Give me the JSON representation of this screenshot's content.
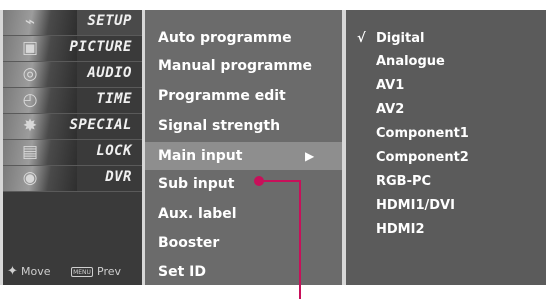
{
  "sidebar": {
    "items": [
      {
        "label": "SETUP",
        "icon": "antenna-icon",
        "glyph": "⌁",
        "active": true
      },
      {
        "label": "PICTURE",
        "icon": "film-icon",
        "glyph": "▣",
        "active": false
      },
      {
        "label": "AUDIO",
        "icon": "speaker-icon",
        "glyph": "◎",
        "active": false
      },
      {
        "label": "TIME",
        "icon": "clock-icon",
        "glyph": "◴",
        "active": false
      },
      {
        "label": "SPECIAL",
        "icon": "special-badge-icon",
        "glyph": "✸",
        "active": false
      },
      {
        "label": "LOCK",
        "icon": "padlock-icon",
        "glyph": "▤",
        "active": false
      },
      {
        "label": "DVR",
        "icon": "disc-icon",
        "glyph": "◉",
        "active": false
      }
    ],
    "legend": {
      "move_label": "Move",
      "menu_key": "MENU",
      "prev_label": "Prev"
    }
  },
  "menu": {
    "items": [
      {
        "label": "Auto programme"
      },
      {
        "label": "Manual programme"
      },
      {
        "label": "Programme edit"
      },
      {
        "label": "Signal strength"
      },
      {
        "label": "Main input",
        "selected": true,
        "arrow": "▶"
      },
      {
        "label": "Sub input"
      },
      {
        "label": "Aux. label"
      },
      {
        "label": "Booster"
      },
      {
        "label": "Set ID"
      }
    ]
  },
  "input_options": {
    "items": [
      {
        "label": "Digital",
        "checked": true,
        "check_glyph": "√"
      },
      {
        "label": "Analogue"
      },
      {
        "label": "AV1"
      },
      {
        "label": "AV2"
      },
      {
        "label": "Component1"
      },
      {
        "label": "Component2"
      },
      {
        "label": "RGB-PC"
      },
      {
        "label": "HDMI1/DVI"
      },
      {
        "label": "HDMI2"
      }
    ]
  },
  "colors": {
    "pointer": "#c8105a",
    "sidebar_bg": "#3a3a3a",
    "menu_bg": "#6b6b6b",
    "menu_selected_bg": "#8e8e8e",
    "options_bg": "#5b5b5b"
  }
}
